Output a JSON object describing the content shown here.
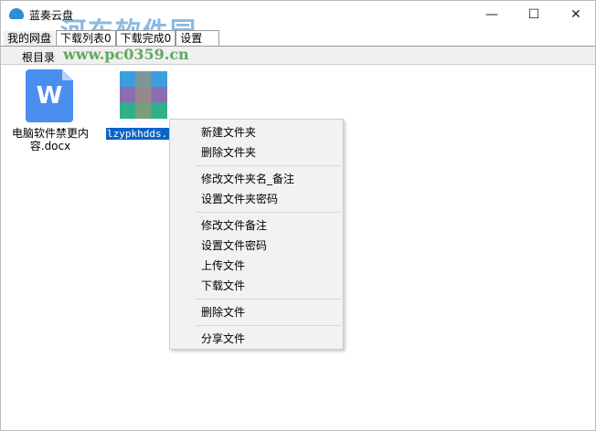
{
  "window": {
    "title": "蓝奏云盘"
  },
  "tabs": [
    {
      "label": "我的网盘"
    },
    {
      "label": "下载列表0"
    },
    {
      "label": "下载完成0"
    },
    {
      "label": "设置"
    }
  ],
  "path": "根目录",
  "files": [
    {
      "name": "电脑软件禁更内容.docx",
      "icon": "word-doc-icon"
    },
    {
      "name": "lzypkhdds.r",
      "icon": "image-icon",
      "selected": true
    }
  ],
  "context_menu": {
    "groups": [
      [
        "新建文件夹",
        "删除文件夹"
      ],
      [
        "修改文件夹名_备注",
        "设置文件夹密码"
      ],
      [
        "修改文件备注",
        "设置文件密码",
        "上传文件",
        "下载文件"
      ],
      [
        "删除文件"
      ],
      [
        "分享文件"
      ]
    ]
  },
  "watermark": {
    "name": "河东软件园",
    "url": "www.pc0359.cn"
  }
}
